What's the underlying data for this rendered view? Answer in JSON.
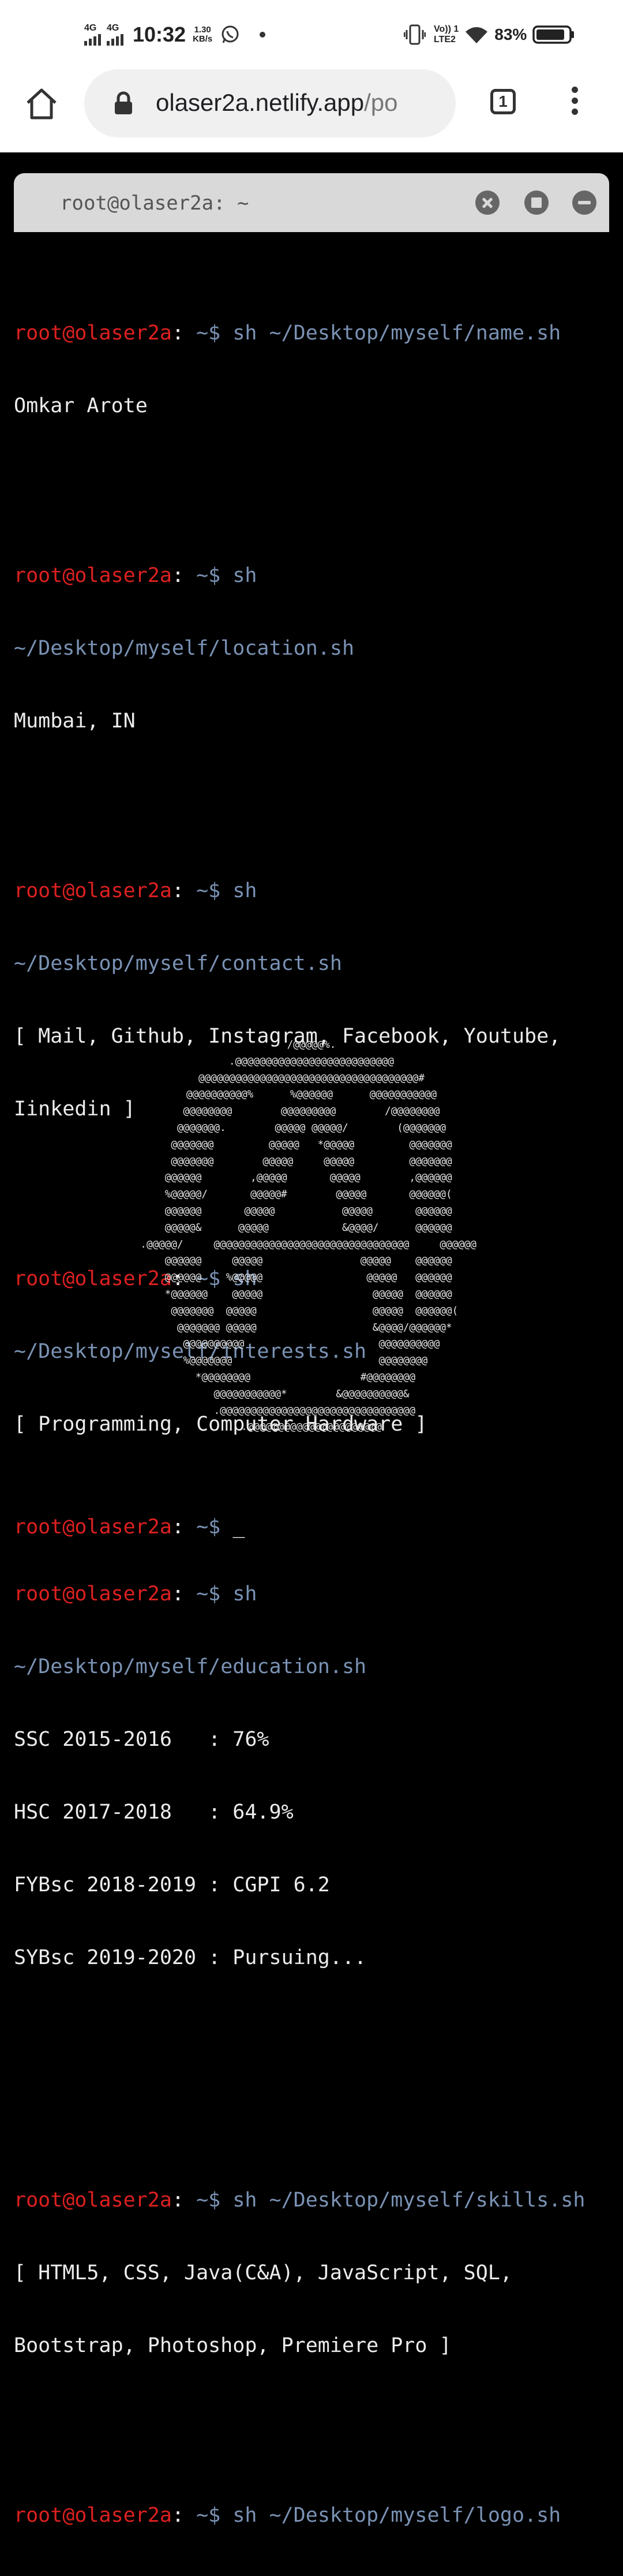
{
  "status_bar": {
    "network1": "4G",
    "network2": "4G",
    "time": "10:32",
    "speed_value": "1.30",
    "speed_unit": "KB/s",
    "volte": "Vo)) 1",
    "lte": "LTE2",
    "battery": "83%"
  },
  "browser": {
    "url_main": "olaser2a.netlify.app",
    "url_dim": "/po",
    "tab_count": "1"
  },
  "terminal": {
    "title": "root@olaser2a: ~",
    "user": "root@olaser2a",
    "colon": ":",
    "path": " ~$ ",
    "entries": [
      {
        "cmd": "sh ~/Desktop/myself/name.sh",
        "out": [
          "Omkar Arote"
        ]
      },
      {
        "cmd_a": "sh",
        "cmd_b": "~/Desktop/myself/location.sh",
        "out": [
          "Mumbai, IN"
        ]
      },
      {
        "cmd_a": "sh",
        "cmd_b": "~/Desktop/myself/contact.sh",
        "out": [
          "[ Mail, Github, Instagram, Facebook, Youtube,",
          "Iinkedin ]"
        ]
      },
      {
        "cmd_a": "sh",
        "cmd_b": "~/Desktop/myself/interests.sh",
        "out": [
          "[ Programming, Computer Hardware ]"
        ]
      },
      {
        "cmd_a": "sh",
        "cmd_b": "~/Desktop/myself/education.sh",
        "out": [
          "SSC 2015-2016   : 76%",
          "HSC 2017-2018   : 64.9%",
          "FYBsc 2018-2019 : CGPI 6.2",
          "SYBsc 2019-2020 : Pursuing..."
        ]
      },
      {
        "cmd": "sh ~/Desktop/myself/skills.sh",
        "out": [
          "[ HTML5, CSS, Java(C&A), JavaScript, SQL,",
          "Bootstrap, Photoshop, Premiere Pro ]"
        ]
      },
      {
        "cmd": "sh ~/Desktop/myself/logo.sh"
      }
    ],
    "cursor": "_",
    "ascii_logo": [
      "                    /@@@@@%.                    ",
      "           .@@@@@@@@@@@@@@@@@@@@@@@@@@           ",
      "      @@@@@@@@@@@@@@@@@@@@@@@@@@@@@@@@@@@@#      ",
      "    @@@@@@@@@@%      %@@@@@@      @@@@@@@@@@@    ",
      "   @@@@@@@@        @@@@@@@@@        /@@@@@@@@   ",
      "  @@@@@@@.        @@@@@ @@@@@/        (@@@@@@@  ",
      " @@@@@@@         @@@@@   *@@@@@         @@@@@@@ ",
      " @@@@@@@        @@@@@     @@@@@         @@@@@@@ ",
      "@@@@@@        ,@@@@@       @@@@@        ,@@@@@@ ",
      "%@@@@@/       @@@@@#        @@@@@       @@@@@@( ",
      "@@@@@@       @@@@@           @@@@@       @@@@@@ ",
      "@@@@@&      @@@@@            &@@@@/      @@@@@@ ",
      ".@@@@@/     @@@@@@@@@@@@@@@@@@@@@@@@@@@@@@@@     @@@@@@ ",
      "@@@@@@     @@@@@                @@@@@    @@@@@@ ",
      "@@@@@@    %@@@@@                 @@@@@   @@@@@@ ",
      "*@@@@@@    @@@@@                  @@@@@  @@@@@@ ",
      " @@@@@@@  @@@@@                   @@@@@  @@@@@@(",
      "  @@@@@@@ @@@@@                   &@@@@/@@@@@@* ",
      "   @@@@@@@@@@                      @@@@@@@@@@   ",
      "   %@@@@@@@                        @@@@@@@@     ",
      "     *@@@@@@@@                  #@@@@@@@@       ",
      "        @@@@@@@@@@@*        &@@@@@@@@@@&        ",
      "           .@@@@@@@@@@@@@@@@@@@@@@@@@@@@@@@@          ",
      "                .@@@@@@@@@@@@@@@@@@@@@@                "
    ]
  }
}
